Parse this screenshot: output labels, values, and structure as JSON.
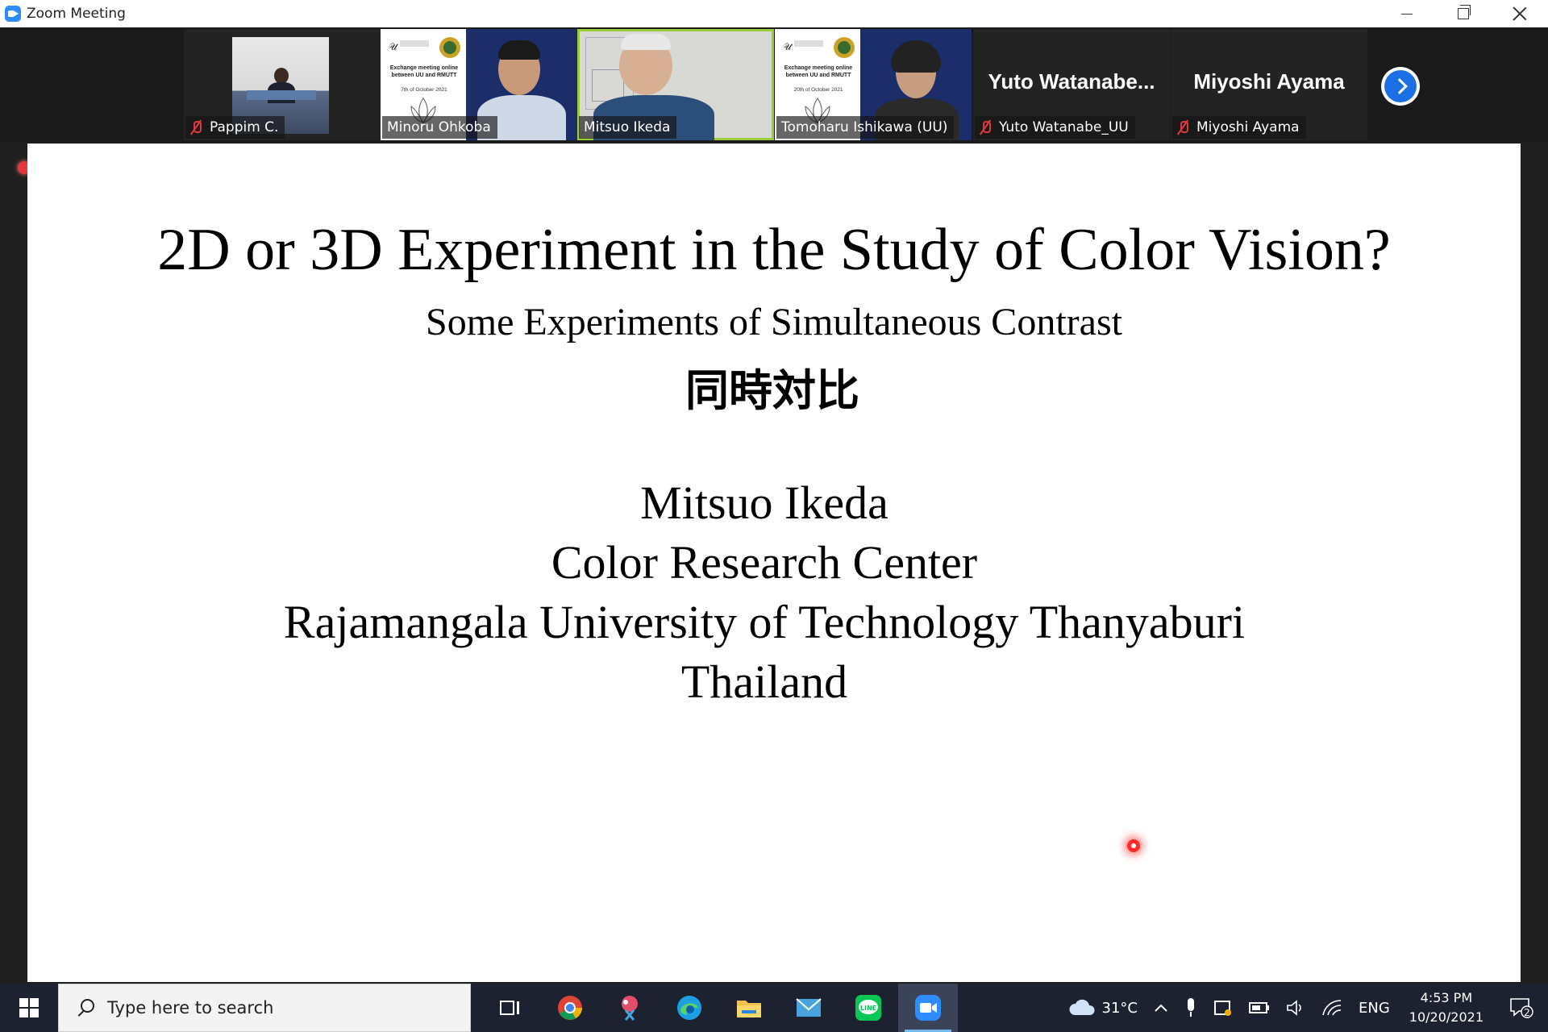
{
  "window": {
    "title": "Zoom Meeting"
  },
  "participants": [
    {
      "name": "Pappim C.",
      "muted": true,
      "video": true
    },
    {
      "name": "Minoru Ohkoba",
      "muted": false,
      "video": true
    },
    {
      "name": "Mitsuo Ikeda",
      "muted": false,
      "video": true,
      "active_speaker": true
    },
    {
      "name": "Tomoharu Ishikawa (UU)",
      "muted": false,
      "video": true
    },
    {
      "name": "Yuto Watanabe_UU",
      "display_name": "Yuto  Watanabe...",
      "muted": true,
      "video": false
    },
    {
      "name": "Miyoshi Ayama",
      "display_name": "Miyoshi Ayama",
      "muted": true,
      "video": false
    }
  ],
  "banners": [
    {
      "line1": "Exchange meeting online",
      "line2": "between UU and RMUTT",
      "date": "7th of October 2021"
    },
    {
      "line1": "Exchange meeting online",
      "line2": "between UU and RMUTT",
      "date": "20th of October 2021"
    }
  ],
  "slide": {
    "title": "2D or 3D Experiment in the Study of Color Vision?",
    "subtitle": "Some Experiments of Simultaneous Contrast",
    "subtitle_ja": "同時対比",
    "author": "Mitsuo Ikeda",
    "org_line1": "Color Research Center",
    "org_line2": "Rajamangala University of Technology Thanyaburi",
    "country": "Thailand"
  },
  "taskbar": {
    "search_placeholder": "Type here to search",
    "weather": "31°C",
    "language": "ENG",
    "time": "4:53 PM",
    "date": "10/20/2021",
    "notifications": "2"
  },
  "colors": {
    "active_speaker": "#9ccc3c",
    "zoom_blue": "#2d8cff",
    "taskbar_bg": "#1c2230"
  }
}
